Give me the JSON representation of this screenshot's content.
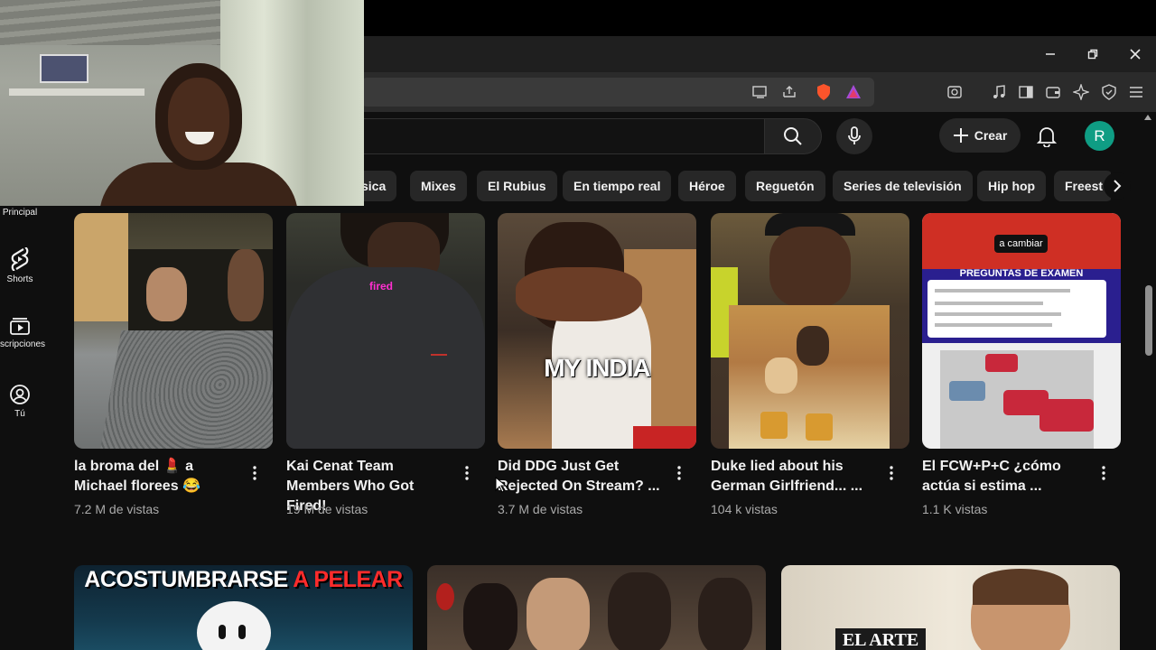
{
  "header": {
    "create_label": "Crear",
    "avatar_letter": "R"
  },
  "chips": [
    {
      "label": "sica"
    },
    {
      "label": "Mixes"
    },
    {
      "label": "El Rubius"
    },
    {
      "label": "En tiempo real"
    },
    {
      "label": "Héroe"
    },
    {
      "label": "Reguetón"
    },
    {
      "label": "Series de televisión"
    },
    {
      "label": "Hip hop"
    },
    {
      "label": "Freest"
    }
  ],
  "sidebar": {
    "items": [
      {
        "label": "Principal",
        "icon": "home-icon"
      },
      {
        "label": "Shorts",
        "icon": "shorts-icon"
      },
      {
        "label": "scripciones",
        "icon": "subscriptions-icon"
      },
      {
        "label": "Tú",
        "icon": "you-icon"
      }
    ]
  },
  "videos": [
    {
      "title": "la broma del 💄 a Michael florees 😂",
      "views": "7.2 M de vistas",
      "overlay": ""
    },
    {
      "title": "Kai Cenat Team Members Who Got Fired!",
      "views": "19 M de vistas",
      "overlay": "fired"
    },
    {
      "title": "Did DDG Just Get Rejected On Stream? ...",
      "views": "3.7 M de vistas",
      "overlay": "MY INDIA"
    },
    {
      "title": "Duke lied about his German Girlfriend... ...",
      "views": "104 k vistas",
      "overlay": ""
    },
    {
      "title": "El FCW+P+C ¿cómo actúa si estima ...",
      "views": "1.1 K vistas",
      "overlay": "a cambiar",
      "overlay2": "PREGUNTAS DE EXAMEN"
    }
  ],
  "row2": [
    {
      "overlay_white": "ACOSTUMBRARSE",
      "overlay_red": "A PELEAR"
    },
    {
      "overlay_white": ""
    },
    {
      "overlay_white": "EL ARTE"
    }
  ],
  "colors": {
    "background": "#0f0f0f",
    "chip": "#272727",
    "avatar": "#0f9d84",
    "meta_text": "#aaaaaa"
  }
}
